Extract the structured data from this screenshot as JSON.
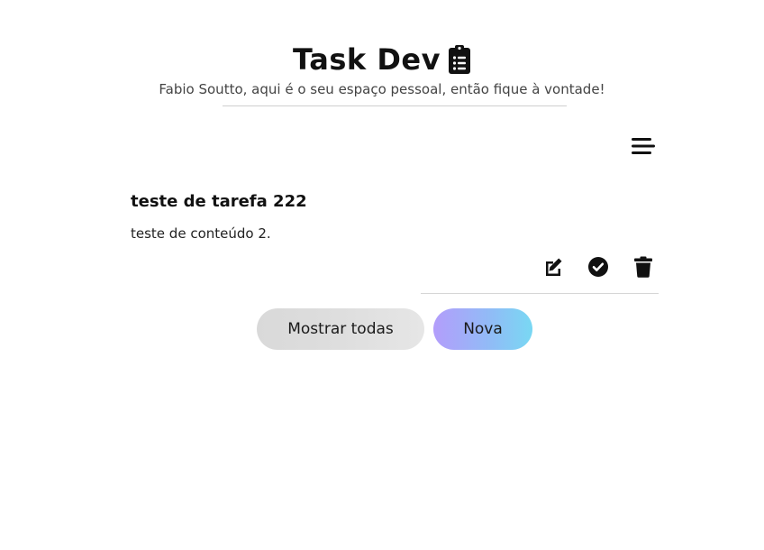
{
  "header": {
    "title": "Task Dev",
    "title_icon": "clipboard-list-icon",
    "subtitle": "Fabio Soutto, aqui é o seu espaço pessoal, então fique à vontade!"
  },
  "menu": {
    "icon": "hamburger-menu-icon"
  },
  "task": {
    "title": "teste de tarefa 222",
    "content": "teste de conteúdo 2.",
    "actions": [
      {
        "icon": "edit-icon"
      },
      {
        "icon": "check-circle-icon"
      },
      {
        "icon": "trash-icon"
      }
    ]
  },
  "buttons": {
    "show_all_label": "Mostrar todas",
    "new_label": "Nova"
  },
  "colors": {
    "text": "#111111",
    "subtitle": "#444444",
    "new_gradient_start": "#b39dfb",
    "new_gradient_end": "#79d8f3",
    "show_all_bg": "#dedede"
  }
}
